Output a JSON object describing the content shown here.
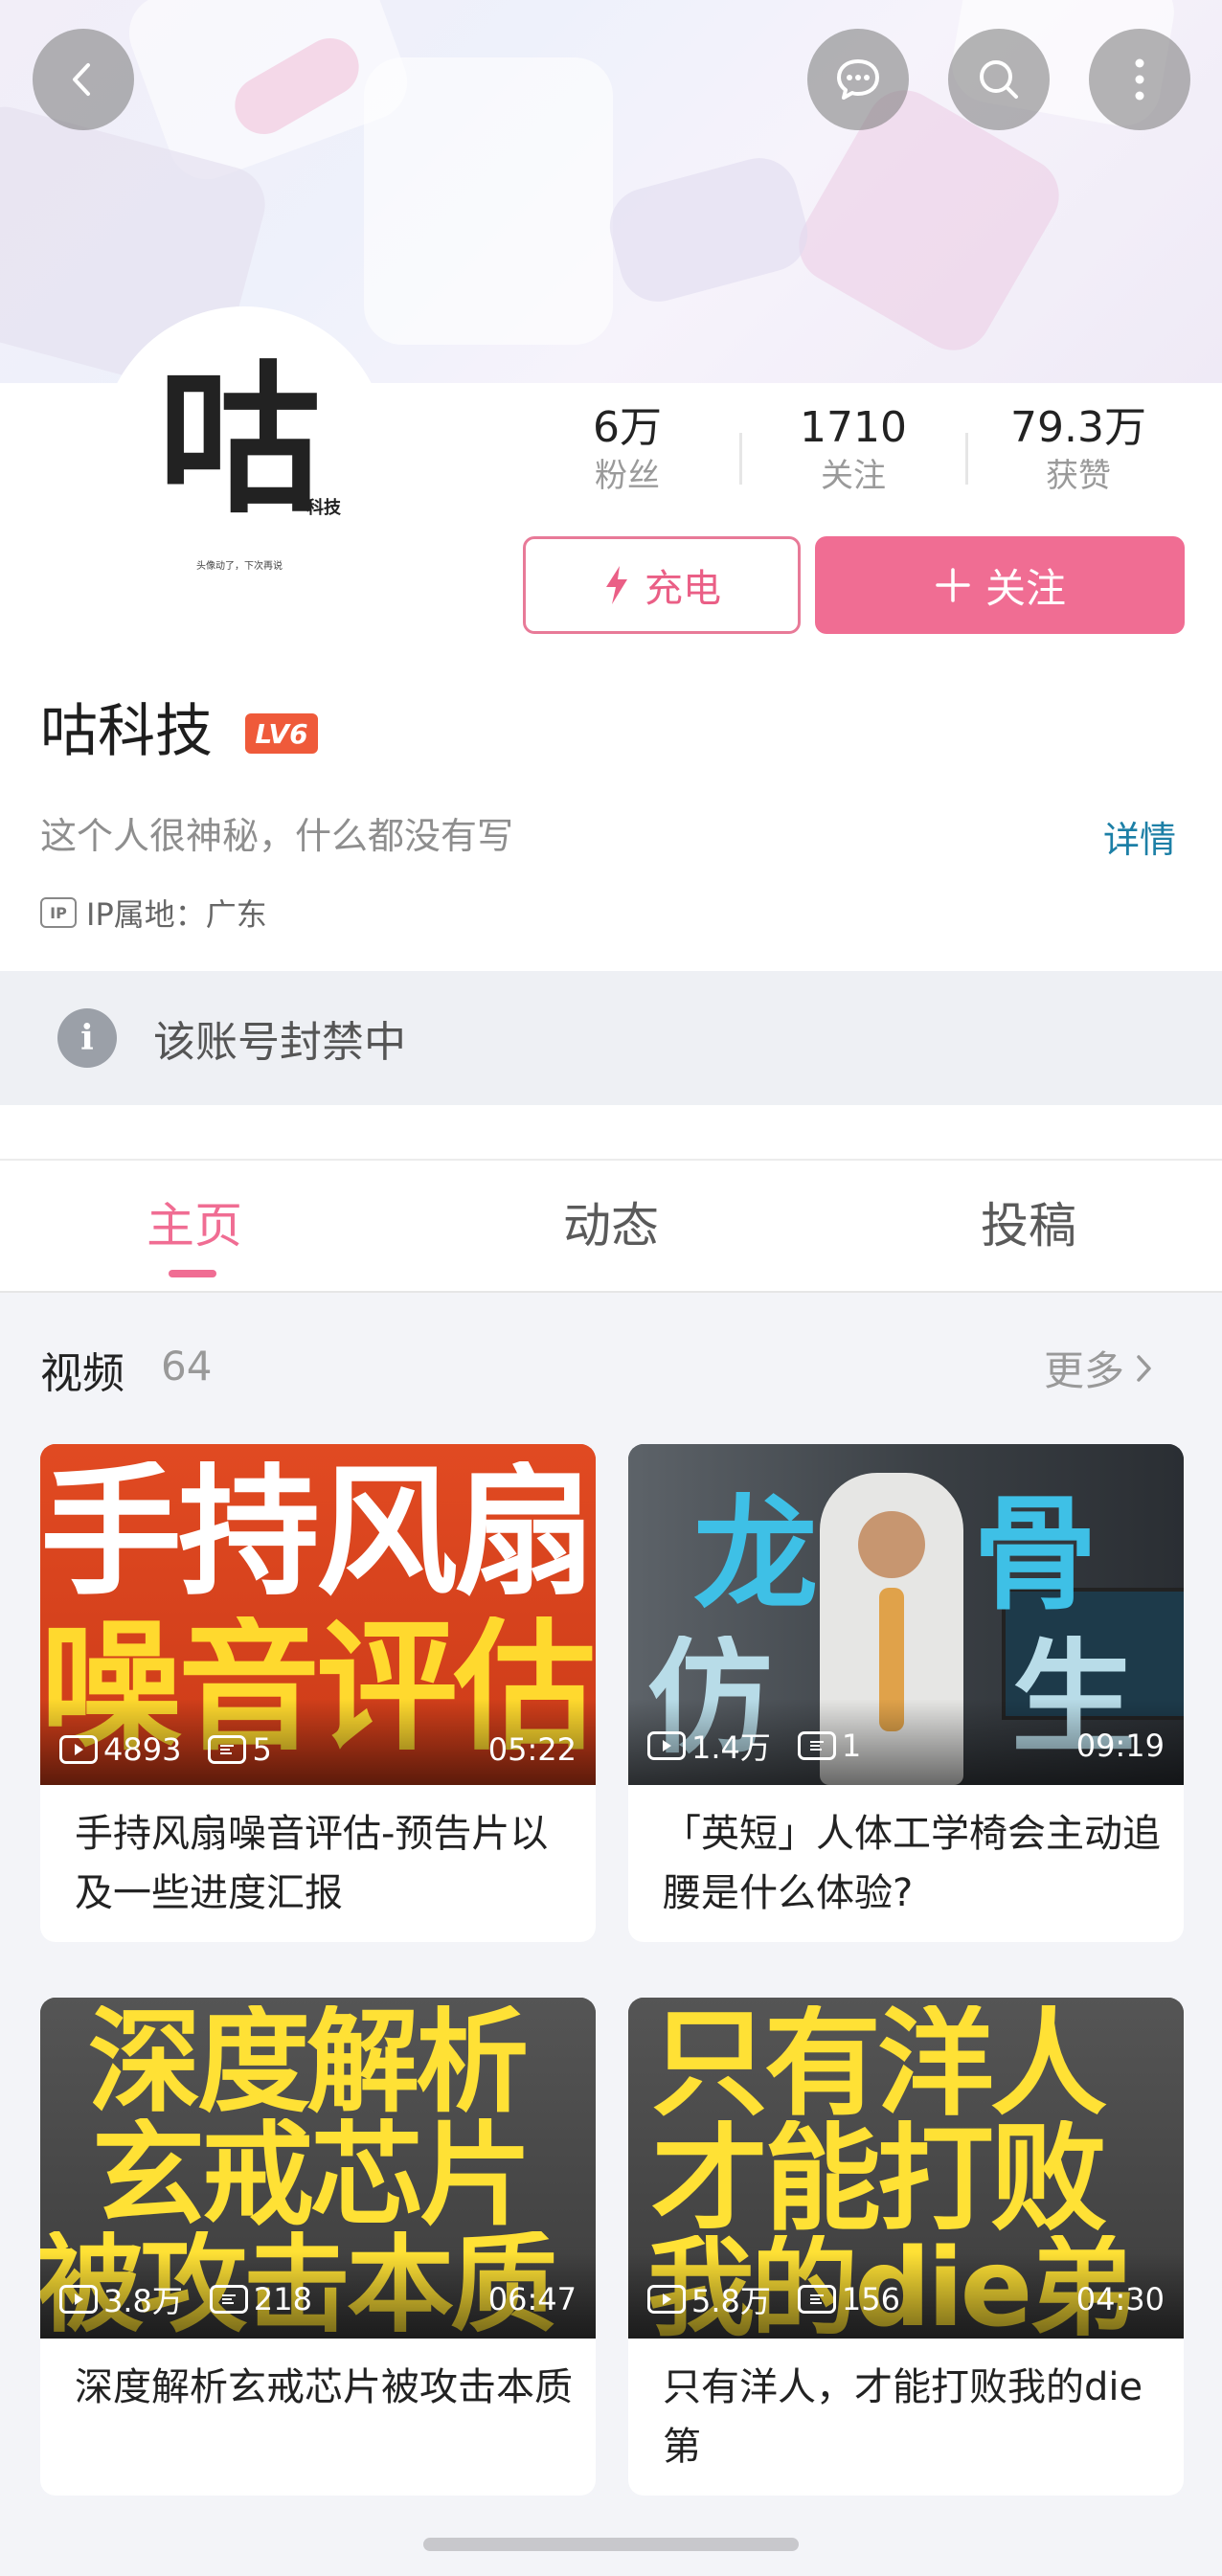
{
  "header": {
    "icons": [
      "back-arrow-icon",
      "chat-bubble-icon",
      "search-icon",
      "more-vertical-icon"
    ]
  },
  "profile": {
    "avatar": {
      "glyph": "咕",
      "sub": "科技",
      "slogan": "头像动了，下次再说"
    },
    "stats": [
      {
        "value": "6万",
        "label": "粉丝"
      },
      {
        "value": "1710",
        "label": "关注"
      },
      {
        "value": "79.3万",
        "label": "获赞"
      }
    ],
    "charge_label": "充电",
    "follow_label": "关注",
    "name": "咕科技",
    "level": "LV6",
    "bio": "这个人很神秘，什么都没有写",
    "detail_link": "详情",
    "ip_badge": "IP",
    "ip_location": "IP属地：广东"
  },
  "notice": {
    "text": "该账号封禁中"
  },
  "tabs": [
    {
      "label": "主页",
      "active": true
    },
    {
      "label": "动态",
      "active": false
    },
    {
      "label": "投稿",
      "active": false
    }
  ],
  "videos_section": {
    "title": "视频",
    "count": "64",
    "more": "更多",
    "items": [
      {
        "thumb_text": [
          "手持风扇",
          "噪音评估"
        ],
        "views": "4893",
        "danmaku": "5",
        "duration": "05:22",
        "title": "手持风扇噪音评估-预告片以及一些进度汇报"
      },
      {
        "thumb_text": [
          "龙",
          "骨",
          "仿",
          "生"
        ],
        "views": "1.4万",
        "danmaku": "1",
        "duration": "09:19",
        "title": "「英短」人体工学椅会主动追腰是什么体验?"
      },
      {
        "thumb_text": [
          "深度解析",
          "玄戒芯片",
          "被攻击本质"
        ],
        "views": "3.8万",
        "danmaku": "218",
        "duration": "06:47",
        "title": "深度解析玄戒芯片被攻击本质"
      },
      {
        "thumb_text": [
          "只有洋人",
          "才能打败",
          "我的die弟"
        ],
        "views": "5.8万",
        "danmaku": "156",
        "duration": "04:30",
        "title": "只有洋人，才能打败我的die第"
      }
    ]
  },
  "colors": {
    "accent_pink": "#f06d93",
    "link_blue": "#1c7fa6",
    "level_red": "#ef5a3a"
  }
}
